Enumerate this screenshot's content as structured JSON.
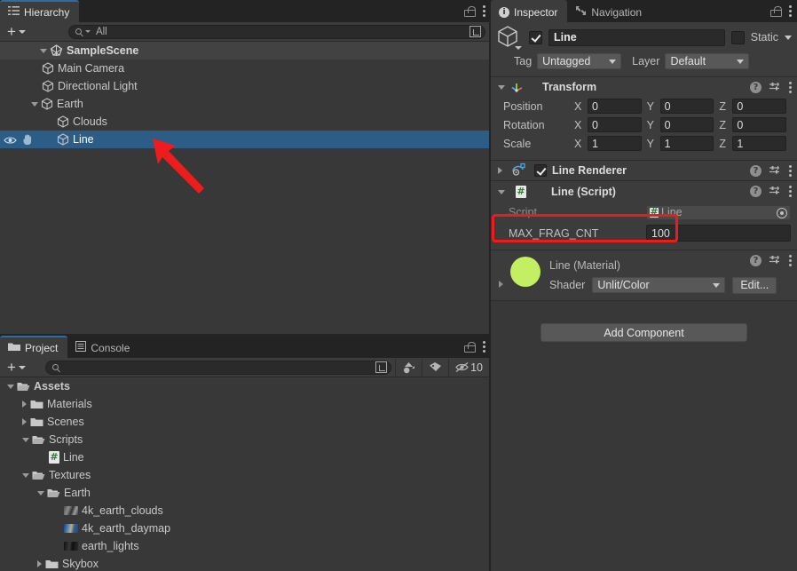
{
  "hierarchy": {
    "tab_label": "Hierarchy",
    "tab_icon": "hierarchy-icon",
    "add_button_label": "+",
    "search_value": "All",
    "search_placeholder": "All",
    "items": [
      {
        "label": "SampleScene",
        "icon": "scene-icon",
        "depth": 0,
        "foldout": "open",
        "selected": false,
        "scene": true
      },
      {
        "label": "Main Camera",
        "icon": "gameobject-icon",
        "depth": 1,
        "foldout": "none",
        "selected": false,
        "scene": false
      },
      {
        "label": "Directional Light",
        "icon": "gameobject-icon",
        "depth": 1,
        "foldout": "none",
        "selected": false,
        "scene": false
      },
      {
        "label": "Earth",
        "icon": "gameobject-icon",
        "depth": 1,
        "foldout": "open",
        "selected": false,
        "scene": false
      },
      {
        "label": "Clouds",
        "icon": "gameobject-icon",
        "depth": 2,
        "foldout": "none",
        "selected": false,
        "scene": false
      },
      {
        "label": "Line",
        "icon": "gameobject-icon",
        "depth": 2,
        "foldout": "none",
        "selected": true,
        "scene": false
      }
    ]
  },
  "project": {
    "tabs": [
      {
        "label": "Project",
        "icon": "folder-icon",
        "active": true
      },
      {
        "label": "Console",
        "icon": "console-icon",
        "active": false
      }
    ],
    "add_button_label": "+",
    "search_value": "",
    "search_placeholder": "",
    "badge_count": "10",
    "toolbar_icons": [
      "object-filter-icon",
      "label-filter-icon",
      "hidden-count-icon"
    ],
    "items": [
      {
        "label": "Assets",
        "icon": "folder-open-icon",
        "depth": 0,
        "foldout": "open",
        "bold": true
      },
      {
        "label": "Materials",
        "icon": "folder-icon",
        "depth": 1,
        "foldout": "closed",
        "bold": false
      },
      {
        "label": "Scenes",
        "icon": "folder-icon",
        "depth": 1,
        "foldout": "closed",
        "bold": false
      },
      {
        "label": "Scripts",
        "icon": "folder-open-icon",
        "depth": 1,
        "foldout": "open",
        "bold": false
      },
      {
        "label": "Line",
        "icon": "cs-script-icon",
        "depth": 2,
        "foldout": "none",
        "bold": false
      },
      {
        "label": "Textures",
        "icon": "folder-open-icon",
        "depth": 1,
        "foldout": "open",
        "bold": false
      },
      {
        "label": "Earth",
        "icon": "folder-open-icon",
        "depth": 2,
        "foldout": "open",
        "bold": false
      },
      {
        "label": "4k_earth_clouds",
        "icon": "texture-clouds-icon",
        "depth": 3,
        "foldout": "none",
        "bold": false
      },
      {
        "label": "4k_earth_daymap",
        "icon": "texture-daymap-icon",
        "depth": 3,
        "foldout": "none",
        "bold": false
      },
      {
        "label": "earth_lights",
        "icon": "texture-lights-icon",
        "depth": 3,
        "foldout": "none",
        "bold": false
      },
      {
        "label": "Skybox",
        "icon": "folder-icon",
        "depth": 2,
        "foldout": "closed",
        "bold": false
      }
    ]
  },
  "inspector": {
    "tabs": [
      {
        "label": "Inspector",
        "icon": "info-icon",
        "active": true
      },
      {
        "label": "Navigation",
        "icon": "navigation-icon",
        "active": false
      }
    ],
    "gameobject": {
      "enabled": true,
      "name": "Line",
      "static_label": "Static",
      "static_checked": false,
      "tag_label": "Tag",
      "tag_value": "Untagged",
      "layer_label": "Layer",
      "layer_value": "Default"
    },
    "transform": {
      "title": "Transform",
      "expanded": true,
      "rows": [
        {
          "name": "Position",
          "x": "0",
          "y": "0",
          "z": "0"
        },
        {
          "name": "Rotation",
          "x": "0",
          "y": "0",
          "z": "0"
        },
        {
          "name": "Scale",
          "x": "1",
          "y": "1",
          "z": "1"
        }
      ],
      "axes": [
        "X",
        "Y",
        "Z"
      ]
    },
    "line_renderer": {
      "title": "Line Renderer",
      "expanded": false,
      "enabled": true
    },
    "line_script": {
      "title": "Line (Script)",
      "expanded": true,
      "highlighted": true,
      "script_label": "Script",
      "script_value": "Line",
      "max_frag_label": "MAX_FRAG_CNT",
      "max_frag_value": "100"
    },
    "material": {
      "title": "Line (Material)",
      "swatch_color": "#c3ef63",
      "shader_label": "Shader",
      "shader_value": "Unlit/Color",
      "edit_label": "Edit..."
    },
    "add_component_label": "Add Component"
  },
  "annotations": {
    "arrow_color": "#ee1c1c",
    "box_color": "#f01a1a",
    "arrow_target": "hierarchy-line-row",
    "box_target": "line-script-component-header"
  },
  "colors": {
    "selection_blue": "#2c5d87",
    "panel_bg": "#383838",
    "component_bg": "#3c3c3c",
    "tabbar_bg": "#232323",
    "field_bg": "#2a2a2a",
    "button_bg": "#585858",
    "material_swatch": "#c3ef63"
  }
}
